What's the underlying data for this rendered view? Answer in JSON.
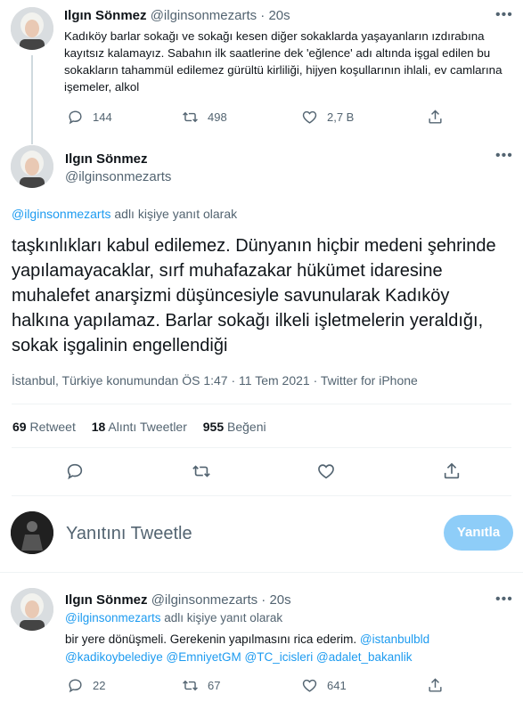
{
  "tweet1": {
    "display_name": "Ilgın Sönmez",
    "handle": "@ilginsonmezarts",
    "separator": "·",
    "time": "20s",
    "text": "Kadıköy barlar sokağı ve sokağı kesen diğer sokaklarda yaşayanların ızdırabına kayıtsız kalamayız. Sabahın ilk saatlerine dek 'eğlence' adı altında işgal edilen bu sokakların tahammül edilemez gürültü kirliliği, hijyen koşullarının ihlali, ev camlarına işemeler, alkol",
    "replies": "144",
    "retweets": "498",
    "likes": "2,7 B"
  },
  "main_tweet": {
    "display_name": "Ilgın Sönmez",
    "handle": "@ilginsonmezarts",
    "reply_to_handle": "@ilginsonmezarts",
    "reply_to_suffix": "adlı kişiye yanıt olarak",
    "text": "taşkınlıkları kabul edilemez. Dünyanın hiçbir medeni şehrinde yapılamayacaklar, sırf muhafazakar hükümet idaresine muhalefet anarşizmi düşüncesiyle savunularak Kadıköy halkına yapılamaz. Barlar sokağı ilkeli işletmelerin yeraldığı, sokak işgalinin engellendiği",
    "meta_location": "İstanbul, Türkiye konumundan",
    "meta_time": "ÖS 1:47",
    "meta_date": "11 Tem 2021",
    "meta_source": "Twitter for iPhone",
    "meta_dot": "·",
    "stats": {
      "retweet_count": "69",
      "retweet_label": "Retweet",
      "quote_count": "18",
      "quote_label": "Alıntı Tweetler",
      "like_count": "955",
      "like_label": "Beğeni"
    }
  },
  "reply_box": {
    "placeholder": "Yanıtını Tweetle",
    "button_label": "Yanıtla"
  },
  "tweet3": {
    "display_name": "Ilgın Sönmez",
    "handle": "@ilginsonmezarts",
    "separator": "·",
    "time": "20s",
    "reply_to_handle": "@ilginsonmezarts",
    "reply_to_suffix": "adlı kişiye yanıt olarak",
    "text_plain": "bir yere dönüşmeli. Gerekenin yapılmasını rica ederim.",
    "mentions": [
      "@istanbulbld",
      "@kadikoybelediye",
      "@EmniyetGM",
      "@TC_icisleri",
      "@adalet_bakanlik"
    ],
    "replies": "22",
    "retweets": "67",
    "likes": "641"
  },
  "colors": {
    "accent": "#1d9bf0",
    "accent_disabled": "#8ecdf8",
    "muted": "#536471",
    "text": "#0f1419",
    "divider": "#eff3f4"
  },
  "icons": [
    "more-icon",
    "reply-icon",
    "retweet-icon",
    "like-icon",
    "share-icon"
  ]
}
